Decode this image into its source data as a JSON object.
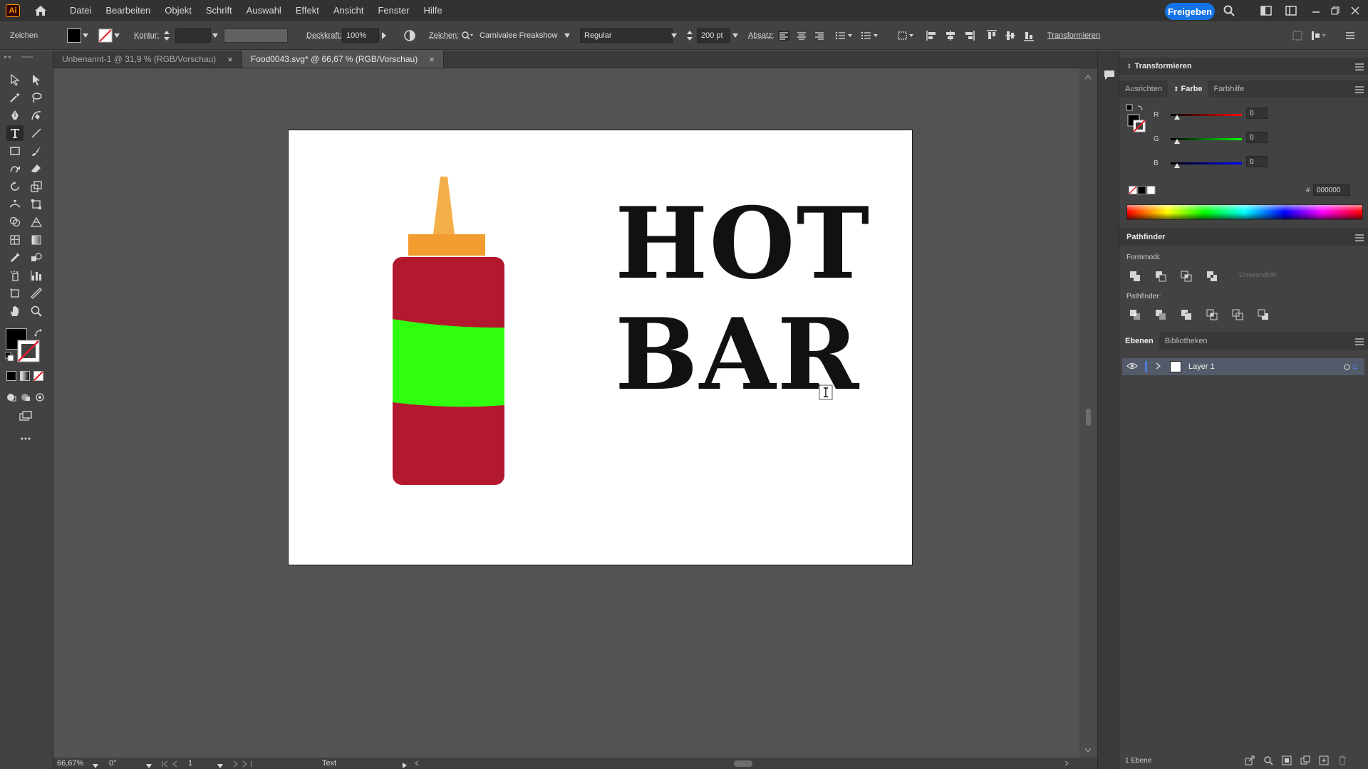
{
  "app": {
    "logo_text": "Ai",
    "menu": [
      "Datei",
      "Bearbeiten",
      "Objekt",
      "Schrift",
      "Auswahl",
      "Effekt",
      "Ansicht",
      "Fenster",
      "Hilfe"
    ],
    "share_label": "Freigeben"
  },
  "control_bar": {
    "mode_label": "Zeichen",
    "stroke_label": "Kontur:",
    "opacity_label": "Deckkraft:",
    "opacity_value": "100%",
    "char_label": "Zeichen:",
    "font_family": "Carnivalee Freakshow",
    "font_style": "Regular",
    "font_size": "200 pt",
    "paragraph_label": "Absatz:",
    "transform_label": "Transformieren"
  },
  "tabs": [
    {
      "label": "Unbenannt-1 @ 31,9 % (RGB/Vorschau)",
      "close": "×",
      "active": false
    },
    {
      "label": "Food0043.svg* @ 66,67 % (RGB/Vorschau)",
      "close": "×",
      "active": true
    }
  ],
  "artboard": {
    "headline_line1": "HOT",
    "headline_line2": "BAR",
    "colors": {
      "bottle_body": "#b2192e",
      "bottle_label": "#31ff10",
      "cap": "#f29b2e",
      "nozzle": "#f3b04a"
    }
  },
  "status": {
    "zoom": "66,67%",
    "rotation": "0°",
    "artboard_nav": "1",
    "tool_name": "Text"
  },
  "panels": {
    "transform_title": "Transformieren",
    "color_tabs": [
      "Ausrichten",
      "Farbe",
      "Farbhilfe"
    ],
    "color_active": "Farbe",
    "rgb": [
      {
        "channel": "R",
        "value": "0"
      },
      {
        "channel": "G",
        "value": "0"
      },
      {
        "channel": "B",
        "value": "0"
      }
    ],
    "hex_symbol": "#",
    "hex_value": "000000",
    "pathfinder_title": "Pathfinder",
    "shape_modes_label": "Formmodi:",
    "expand_label": "Umwandeln",
    "pathfinders_label": "Pathfinder:",
    "layers_tabs": [
      "Ebenen",
      "Bibliotheken"
    ],
    "layer_name": "Layer 1",
    "layer_count": "1 Ebene"
  }
}
